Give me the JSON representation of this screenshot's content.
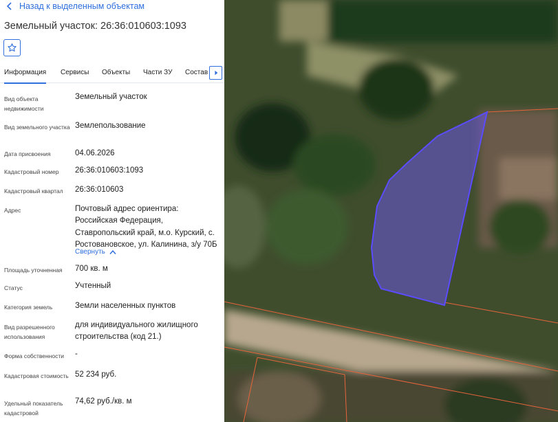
{
  "header": {
    "back_label": "Назад к выделенным объектам",
    "title": "Земельный участок: 26:36:010603:1093"
  },
  "tabs": [
    {
      "label": "Информация",
      "active": true
    },
    {
      "label": "Сервисы"
    },
    {
      "label": "Объекты"
    },
    {
      "label": "Части ЗУ"
    },
    {
      "label": "Состав"
    }
  ],
  "details": [
    {
      "label": "Вид объекта недвижимости",
      "value": "Земельный участок"
    },
    {
      "label": "Вид земельного участка",
      "value": "Землепользование"
    },
    {
      "label": "Дата присвоения",
      "value": "04.06.2026"
    },
    {
      "label": "Кадастровый номер",
      "value": "26:36:010603:1093"
    },
    {
      "label": "Кадастровый квартал",
      "value": "26:36:010603"
    },
    {
      "label": "Адрес",
      "value": "Почтовый адрес ориентира: Российская Федерация, Ставропольский край, м.о. Курский, с. Ростовановское, ул. Калинина, з/у 70Б"
    },
    {
      "label": "Площадь уточненная",
      "value": "700 кв. м"
    },
    {
      "label": "Статус",
      "value": "Учтенный"
    },
    {
      "label": "Категория земель",
      "value": "Земли населенных пунктов"
    },
    {
      "label": "Вид разрешенного использования",
      "value": "для индивидуального жилищного строительства (код 21.)"
    },
    {
      "label": "Форма собственности",
      "value": "-"
    },
    {
      "label": "Кадастровая стоимость",
      "value": "52 234 руб."
    },
    {
      "label": "Удельный показатель кадастровой",
      "value": "74,62 руб./кв. м"
    }
  ],
  "address_collapse_label": "Свернуть",
  "icons": {
    "back": "chevron-left-icon",
    "favorite": "star-icon",
    "tabs_next": "chevron-right-icon",
    "collapse": "chevron-up-icon"
  },
  "colors": {
    "accent": "#2f6fde",
    "selected_parcel_fill": "#6a55e0",
    "selected_parcel_stroke": "#5b4cff",
    "parcel_boundary": "#e8643c"
  }
}
